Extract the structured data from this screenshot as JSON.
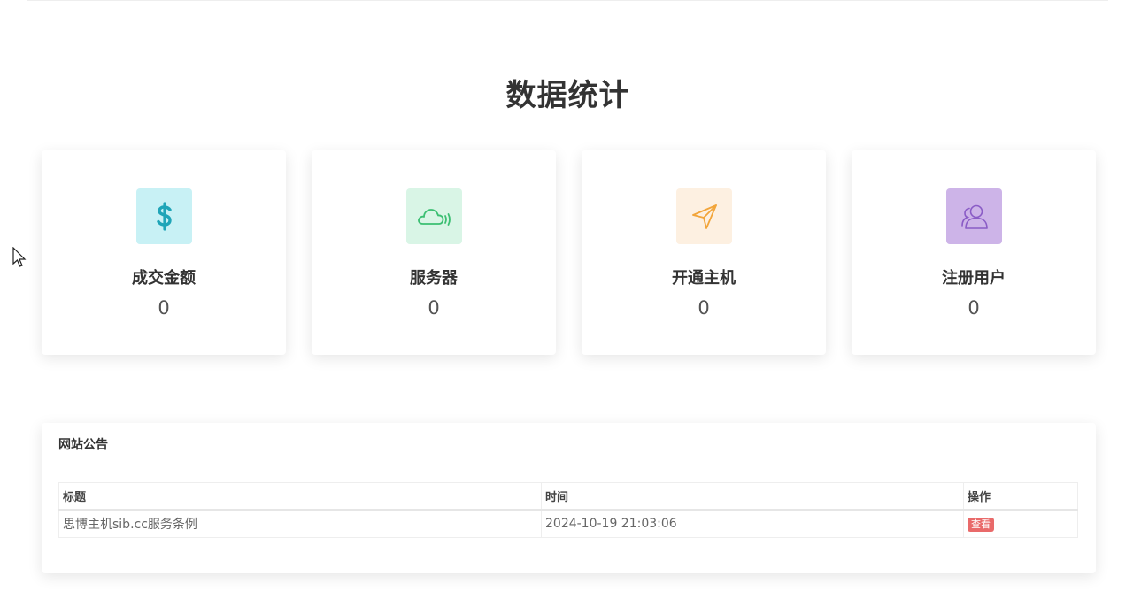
{
  "stats": {
    "title": "数据统计",
    "cards": [
      {
        "label": "成交金额",
        "value": "0",
        "icon": "dollar-icon",
        "icon_bg": "#c8f1f5",
        "icon_color": "#1fa5b8"
      },
      {
        "label": "服务器",
        "value": "0",
        "icon": "cloud-signal-icon",
        "icon_bg": "#d9f5e6",
        "icon_color": "#3bbf72"
      },
      {
        "label": "开通主机",
        "value": "0",
        "icon": "send-arrow-icon",
        "icon_bg": "#fdf0e1",
        "icon_color": "#f2a53a"
      },
      {
        "label": "注册用户",
        "value": "0",
        "icon": "users-icon",
        "icon_bg": "#cdb4e8",
        "icon_color": "#8a5cc6"
      }
    ]
  },
  "announcements": {
    "title": "网站公告",
    "columns": [
      "标题",
      "时间",
      "操作"
    ],
    "rows": [
      {
        "title": "思博主机sib.cc服务条例",
        "time": "2024-10-19 21:03:06",
        "action": "查看"
      }
    ],
    "action_color": "#e96a6a"
  }
}
